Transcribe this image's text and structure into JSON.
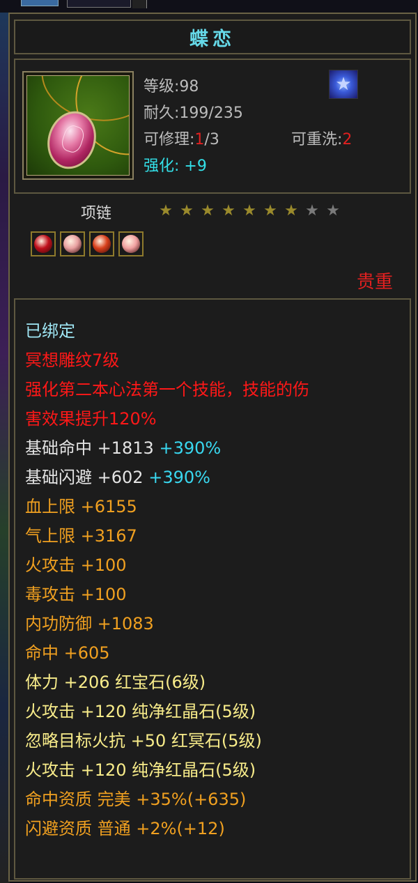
{
  "tooltip": {
    "title": "蝶恋",
    "level_label": "等级:",
    "level_value": "98",
    "durability_label": "耐久:",
    "durability_value": "199/235",
    "repair_label": "可修理:",
    "repair_current": "1",
    "repair_max": "/3",
    "rewash_label": "可重洗:",
    "rewash_value": "2",
    "enhance_label": "强化:",
    "enhance_value": "+9",
    "item_type": "项链",
    "stars_filled": 7,
    "stars_total": 9,
    "rarity": "贵重",
    "gem_colors": [
      "#c0101c",
      "#e8a0a0",
      "#d8401c",
      "#f0a0a0"
    ]
  },
  "attributes": {
    "bound": "已绑定",
    "carving": "冥想雕纹7级",
    "carving_effect_line1": "强化第二本心法第一个技能，技能的伤",
    "carving_effect_line2": "害效果提升120%",
    "base_hit_label": "基础命中",
    "base_hit_value": "+1813",
    "base_hit_bonus": "+390%",
    "base_dodge_label": "基础闪避",
    "base_dodge_value": "+602",
    "base_dodge_bonus": "+390%",
    "hp": "血上限  +6155",
    "qi": "气上限  +3167",
    "fire_atk": "火攻击  +100",
    "poison_atk": "毒攻击  +100",
    "inner_def": "内功防御  +1083",
    "hit": "命中  +605",
    "gem1": "体力 +206 红宝石(6级)",
    "gem2": "火攻击 +120 纯净红晶石(5级)",
    "gem3": "忽略目标火抗 +50 红冥石(5级)",
    "gem4": "火攻击 +120 纯净红晶石(5级)",
    "hit_quality": "命中资质  完美 +35%(+635)",
    "dodge_quality": "闪避资质  普通 +2%(+12)"
  }
}
